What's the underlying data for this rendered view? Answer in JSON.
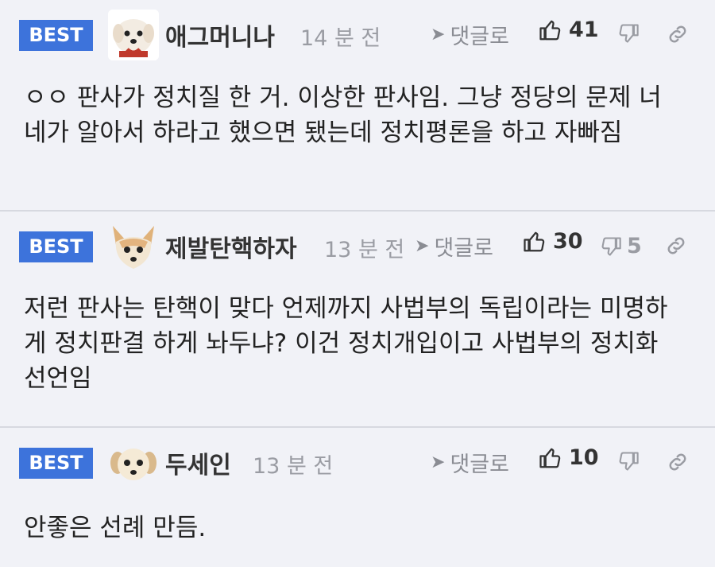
{
  "comments": [
    {
      "badge": "BEST",
      "avatar": "white-dog-avatar",
      "nickname": "애그머니나",
      "time": "14 분 전",
      "reply_label": "댓글로",
      "likes": "41",
      "dislikes": "",
      "text": "ㅇㅇ 판사가 정치질 한 거. 이상한 판사임. 그냥 정당의 문제 너네가 알아서 하라고 했으면 됐는데 정치평론을 하고 자빠짐"
    },
    {
      "badge": "BEST",
      "avatar": "chihuahua-avatar",
      "nickname": "제발탄핵하자",
      "time": "13 분 전",
      "reply_label": "댓글로",
      "likes": "30",
      "dislikes": "5",
      "text": "저런 판사는 탄핵이 맞다 언제까지 사법부의 독립이라는 미명하게 정치판결 하게 놔두냐? 이건 정치개입이고 사법부의 정치화 선언임"
    },
    {
      "badge": "BEST",
      "avatar": "puppy-avatar",
      "nickname": "두세인",
      "time": "13 분 전",
      "reply_label": "댓글로",
      "likes": "10",
      "dislikes": "",
      "text": "안좋은 선례 만듬."
    }
  ],
  "colors": {
    "badge_bg": "#3d73db",
    "background": "#f1f2f7",
    "muted": "#9a9ca3"
  }
}
